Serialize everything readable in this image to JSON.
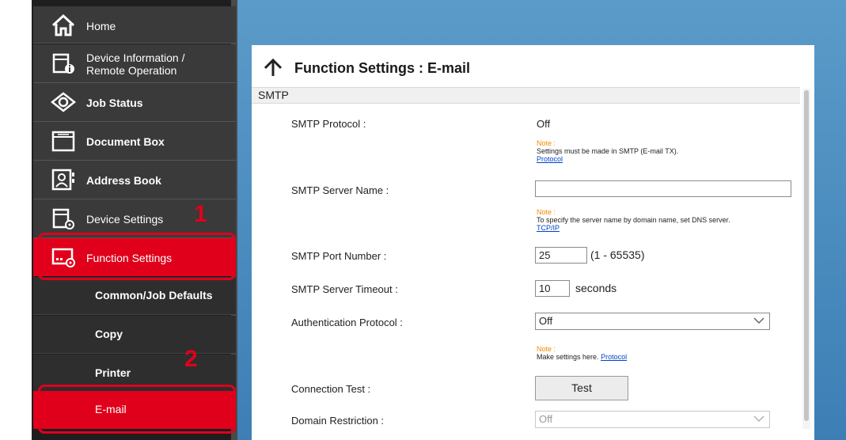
{
  "sidebar": {
    "items": [
      {
        "label": "Home",
        "icon": "home-icon"
      },
      {
        "label": "Device Information /",
        "label2": "Remote Operation",
        "icon": "device-info-icon"
      },
      {
        "label": "Job Status",
        "icon": "job-status-icon"
      },
      {
        "label": "Document Box",
        "icon": "document-box-icon"
      },
      {
        "label": "Address Book",
        "icon": "address-book-icon"
      },
      {
        "label": "Device Settings",
        "icon": "device-settings-icon"
      },
      {
        "label": "Function Settings",
        "icon": "function-settings-icon"
      }
    ],
    "sub_items": [
      {
        "label": "Common/Job Defaults"
      },
      {
        "label": "Copy"
      },
      {
        "label": "Printer"
      },
      {
        "label": "E-mail"
      }
    ],
    "callouts": {
      "first": "1",
      "second": "2"
    },
    "accent_color": "#e0001b"
  },
  "panel": {
    "title": "Function Settings : E-mail",
    "section": "SMTP",
    "fields": {
      "smtp_protocol": {
        "label": "SMTP Protocol :",
        "value": "Off"
      },
      "smtp_protocol_note": {
        "note": "Note :",
        "text": "Settings must be made in SMTP (E-mail TX).",
        "link": "Protocol"
      },
      "smtp_server_name": {
        "label": "SMTP Server Name :",
        "value": ""
      },
      "smtp_server_note": {
        "note": "Note :",
        "text": "To specify the server name by domain name, set DNS server.",
        "link": "TCP/IP"
      },
      "smtp_port": {
        "label": "SMTP Port Number :",
        "value": "25",
        "range": "(1 - 65535)"
      },
      "smtp_timeout": {
        "label": "SMTP Server Timeout :",
        "value": "10",
        "unit": "seconds"
      },
      "auth_protocol": {
        "label": "Authentication Protocol :",
        "value": "Off"
      },
      "auth_note": {
        "note": "Note :",
        "text": "Make settings here.",
        "link": "Protocol"
      },
      "connection_test": {
        "label": "Connection Test :",
        "button": "Test"
      },
      "domain_restriction": {
        "label": "Domain Restriction :",
        "value": "Off"
      }
    }
  }
}
